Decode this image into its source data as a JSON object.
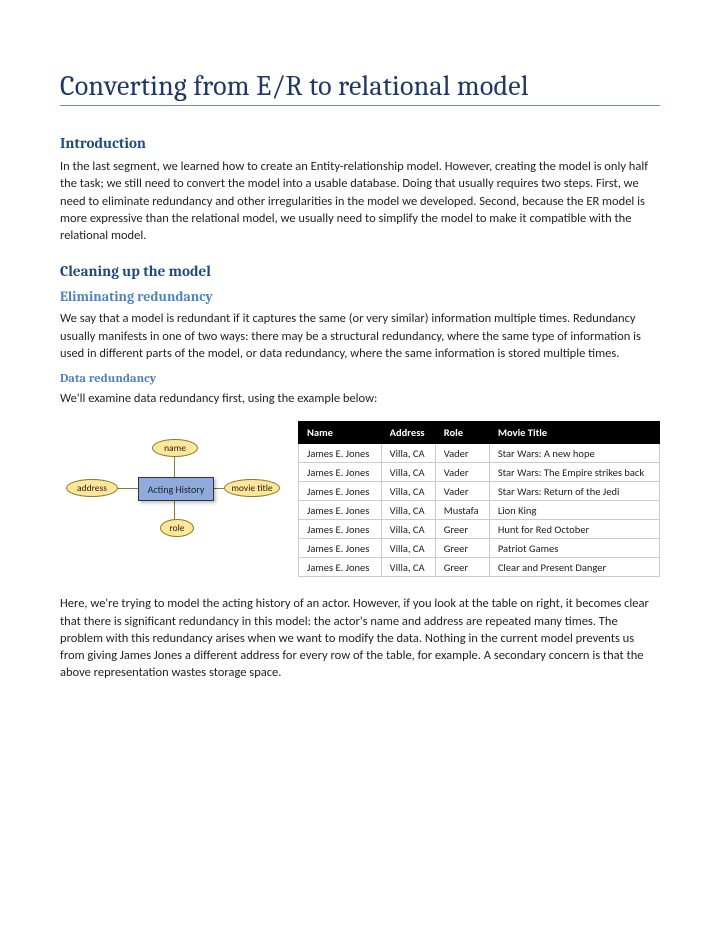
{
  "title": "Converting from E/R to relational model",
  "sections": {
    "intro": {
      "heading": "Introduction",
      "p1": "In the last segment, we learned how to create an Entity-relationship model.  However, creating the model is only half the task; we still need to convert the model into a usable database.  Doing that usually requires two steps.  First, we need to eliminate redundancy and other irregularities in the model we developed.  Second, because the ER model is more expressive than the relational model, we usually need to simplify the model to make it compatible with the relational model."
    },
    "cleaning": {
      "heading": "Cleaning up the model",
      "elimHeading": "Eliminating redundancy",
      "elimP1": "We say that a model is redundant if it captures the same (or very similar) information multiple times.  Redundancy usually manifests in one of two ways: there may be a structural redundancy, where the same type of information is used in different parts of the model, or data redundancy, where the same information is stored multiple times.",
      "dataHeading": "Data redundancy",
      "dataP1": "We'll examine data redundancy first, using the example below:",
      "diagram": {
        "entity": "Acting History",
        "attrs": {
          "name": "name",
          "address": "address",
          "movie": "movie title",
          "role": "role"
        }
      },
      "table": {
        "headers": [
          "Name",
          "Address",
          "Role",
          "Movie Title"
        ],
        "rows": [
          [
            "James E. Jones",
            "Villa, CA",
            "Vader",
            "Star Wars: A new hope"
          ],
          [
            "James E. Jones",
            "Villa, CA",
            "Vader",
            "Star Wars: The Empire strikes back"
          ],
          [
            "James E. Jones",
            "Villa, CA",
            "Vader",
            "Star Wars: Return of the Jedi"
          ],
          [
            "James E. Jones",
            "Villa, CA",
            "Mustafa",
            "Lion King"
          ],
          [
            "James E. Jones",
            "Villa, CA",
            "Greer",
            "Hunt for Red October"
          ],
          [
            "James E. Jones",
            "Villa, CA",
            "Greer",
            "Patriot Games"
          ],
          [
            "James E. Jones",
            "Villa, CA",
            "Greer",
            "Clear and Present Danger"
          ]
        ]
      },
      "afterP1": "Here, we're trying to model the acting history of an actor.  However, if you look at the table on right, it becomes clear that there is significant redundancy in this model: the actor's name and address are repeated many times.  The problem with this redundancy arises when we want to modify the data.  Nothing in the current model prevents us from giving James Jones a different address for every row of the table, for example.  A secondary concern is that the above representation wastes storage space."
    }
  }
}
